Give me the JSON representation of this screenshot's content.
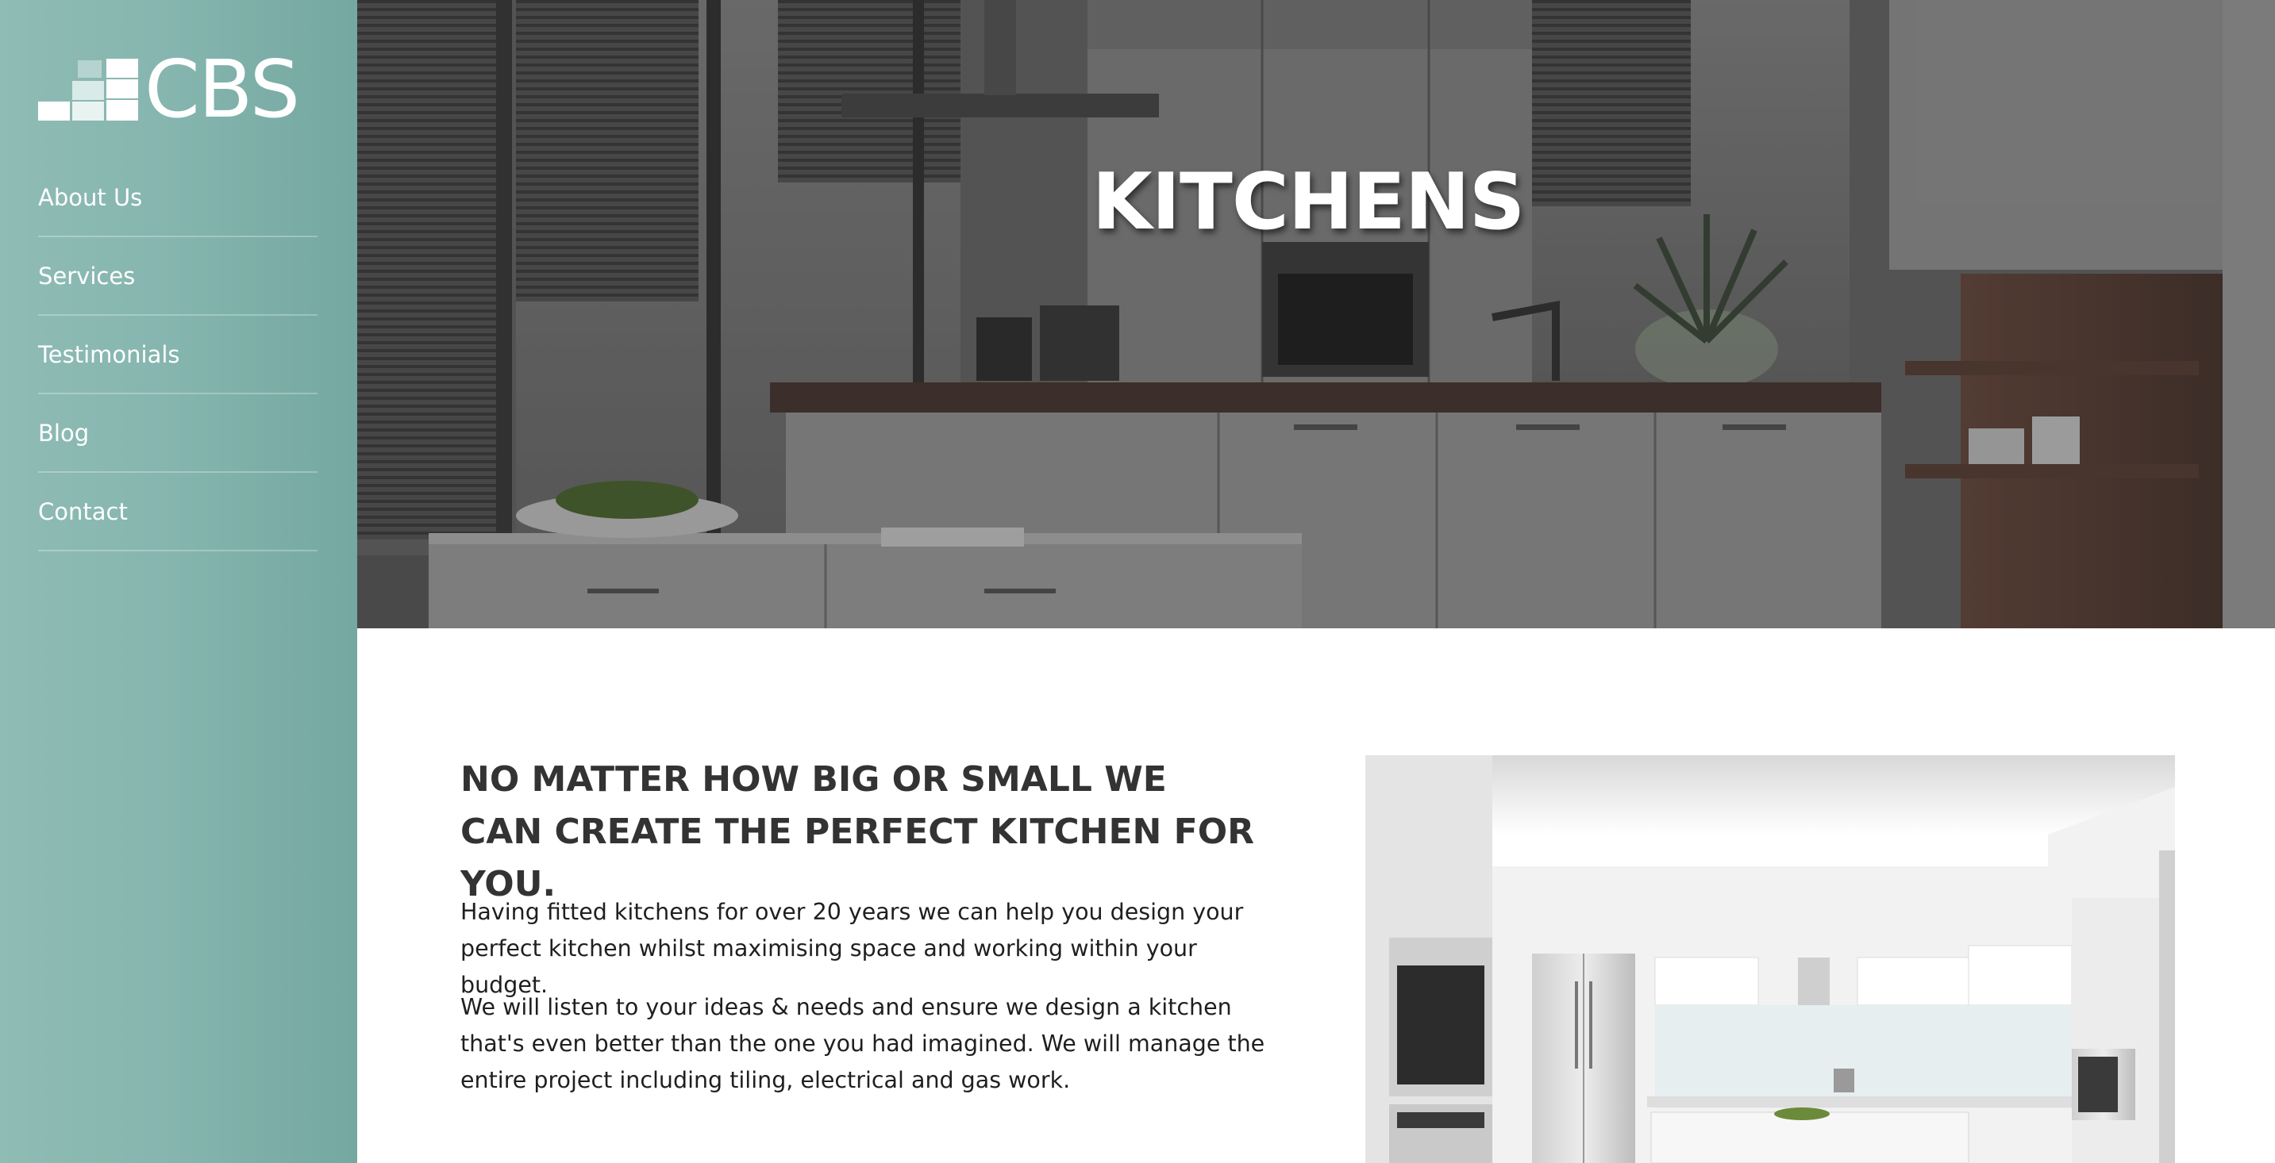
{
  "brand": {
    "name": "CBS"
  },
  "nav": {
    "items": [
      {
        "label": "About Us"
      },
      {
        "label": "Services"
      },
      {
        "label": "Testimonials"
      },
      {
        "label": "Blog"
      },
      {
        "label": "Contact"
      }
    ]
  },
  "hero": {
    "title": "KITCHENS"
  },
  "content": {
    "heading": "NO MATTER HOW BIG OR SMALL WE CAN CREATE THE PERFECT KITCHEN FOR YOU.",
    "paragraph1": "Having fitted kitchens for over 20 years we can help you design your perfect kitchen whilst maximising space and working within your budget.",
    "paragraph2": "We will listen to your ideas & needs and ensure we design a kitchen that's even better than the one you had imagined. We will manage the entire project including tiling, electrical and gas work."
  },
  "colors": {
    "sidebar": "#86b6af",
    "heading_text": "#333333",
    "body_text": "#1f1f1f"
  }
}
